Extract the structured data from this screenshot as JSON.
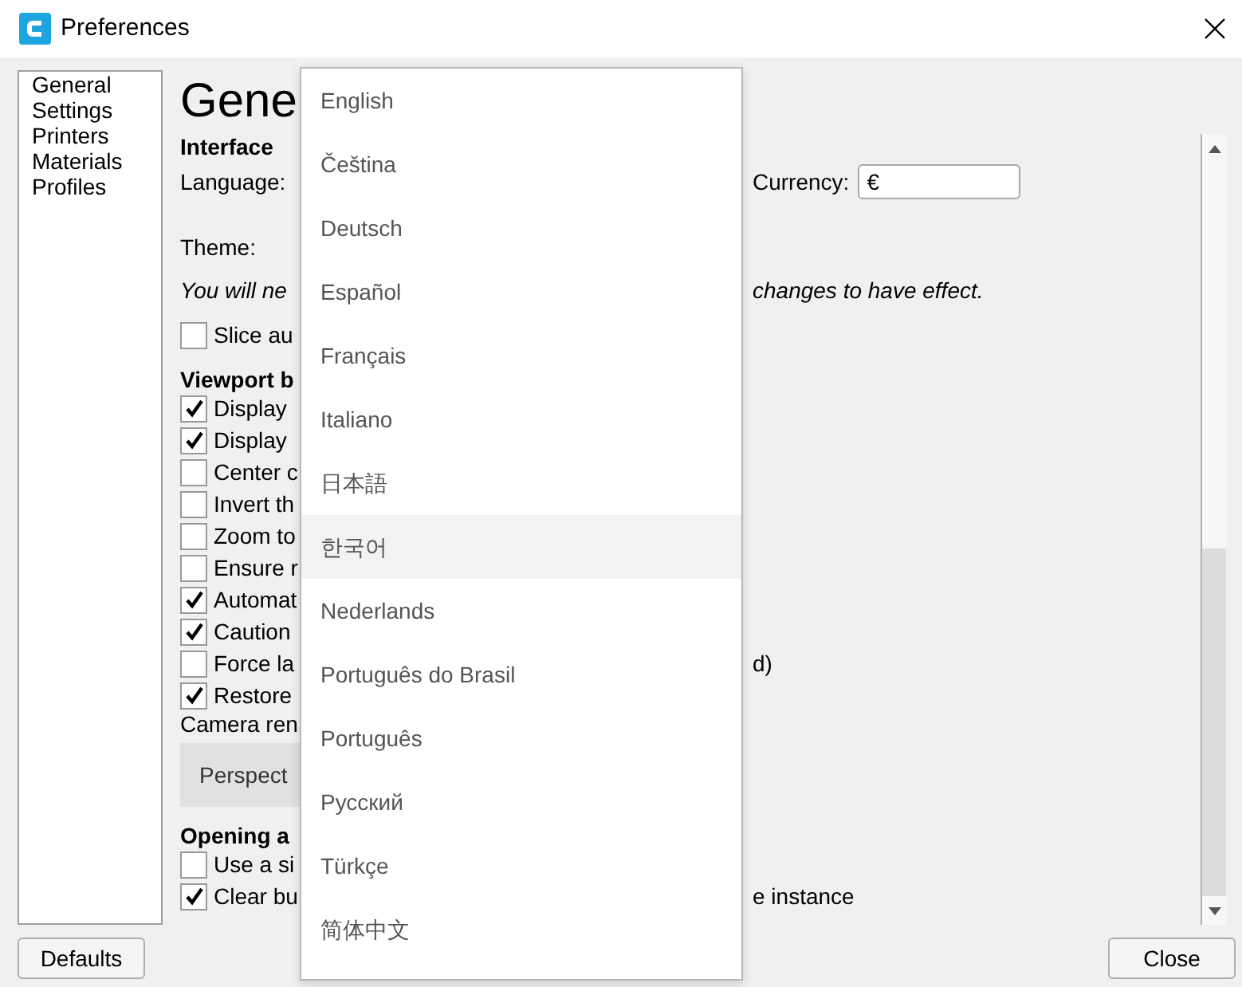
{
  "window": {
    "title": "Preferences"
  },
  "sidebar": {
    "items": [
      {
        "label": "General"
      },
      {
        "label": "Settings"
      },
      {
        "label": "Printers"
      },
      {
        "label": "Materials"
      },
      {
        "label": "Profiles"
      }
    ]
  },
  "page": {
    "title": "Gene",
    "content": [
      {
        "kind": "section",
        "text": "Interface"
      },
      {
        "kind": "field",
        "text": "Language:",
        "right_label": "Currency:",
        "value": "€"
      },
      {
        "kind": "label",
        "text": "Theme:"
      },
      {
        "kind": "note",
        "text": "You will ne",
        "right": "changes to have effect."
      },
      {
        "kind": "check",
        "text": "Slice au",
        "checked": false
      },
      {
        "kind": "section",
        "text": "Viewport b"
      },
      {
        "kind": "check",
        "text": "Display",
        "checked": true
      },
      {
        "kind": "check",
        "text": "Display",
        "checked": true
      },
      {
        "kind": "check",
        "text": "Center c",
        "checked": false
      },
      {
        "kind": "check",
        "text": "Invert th",
        "checked": false
      },
      {
        "kind": "check",
        "text": "Zoom to",
        "checked": false
      },
      {
        "kind": "check",
        "text": "Ensure r",
        "checked": false
      },
      {
        "kind": "check",
        "text": "Automat",
        "checked": true
      },
      {
        "kind": "check",
        "text": "Caution",
        "checked": true
      },
      {
        "kind": "check",
        "text": "Force la",
        "checked": false,
        "right": "d)"
      },
      {
        "kind": "check",
        "text": "Restore",
        "checked": true
      },
      {
        "kind": "label",
        "text": "Camera ren"
      },
      {
        "kind": "button",
        "text": "Perspect"
      },
      {
        "kind": "section",
        "text": "Opening a"
      },
      {
        "kind": "check",
        "text": "Use a si",
        "checked": false
      },
      {
        "kind": "check",
        "text": "Clear bu",
        "checked": true,
        "right": "e instance"
      }
    ]
  },
  "dropdown": {
    "items": [
      {
        "label": "English",
        "highlighted": false
      },
      {
        "label": "Čeština",
        "highlighted": false
      },
      {
        "label": "Deutsch",
        "highlighted": false
      },
      {
        "label": "Español",
        "highlighted": false
      },
      {
        "label": "Français",
        "highlighted": false
      },
      {
        "label": "Italiano",
        "highlighted": false
      },
      {
        "label": "日本語",
        "highlighted": false
      },
      {
        "label": "한국어",
        "highlighted": true
      },
      {
        "label": "Nederlands",
        "highlighted": false
      },
      {
        "label": "Português do Brasil",
        "highlighted": false
      },
      {
        "label": "Português",
        "highlighted": false
      },
      {
        "label": "Русский",
        "highlighted": false
      },
      {
        "label": "Türkçe",
        "highlighted": false
      },
      {
        "label": "简体中文",
        "highlighted": false
      }
    ]
  },
  "buttons": [
    {
      "label": "Defaults"
    },
    {
      "label": "Close"
    }
  ]
}
